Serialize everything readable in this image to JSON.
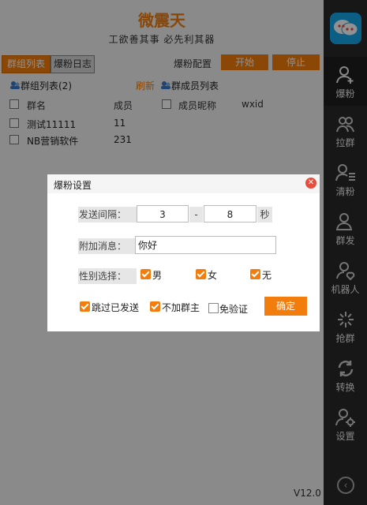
{
  "app": {
    "title": "微震天",
    "subtitle": "工欲善其事 必先利其器",
    "version": "V12.0",
    "accent_color": "#f27d0c",
    "sidebar_color": "#2a2a2a"
  },
  "tabs": {
    "group_list": "群组列表",
    "log": "爆粉日志"
  },
  "toolbar": {
    "config_label": "爆粉配置",
    "start": "开始",
    "stop": "停止"
  },
  "groups": {
    "header": "群组列表(2)",
    "refresh": "刷新",
    "col_name": "群名",
    "col_members": "成员",
    "rows": [
      {
        "name": "测试11111",
        "members": "11"
      },
      {
        "name": "NB营销软件",
        "members": "231"
      }
    ]
  },
  "members": {
    "header": "群成员列表",
    "col_nickname": "成员昵称",
    "col_wxid": "wxid"
  },
  "sidebar": {
    "items": [
      {
        "label": "爆粉",
        "icon": "person-add-icon"
      },
      {
        "label": "拉群",
        "icon": "group-icon"
      },
      {
        "label": "清粉",
        "icon": "person-list-icon"
      },
      {
        "label": "群发",
        "icon": "person-broadcast-icon"
      },
      {
        "label": "机器人",
        "icon": "robot-person-icon"
      },
      {
        "label": "抢群",
        "icon": "sparkle-icon"
      },
      {
        "label": "转换",
        "icon": "refresh-icon"
      },
      {
        "label": "设置",
        "icon": "person-gear-icon"
      }
    ]
  },
  "dialog": {
    "title": "爆粉设置",
    "interval_label": "发送间隔：",
    "interval_min": "3",
    "interval_sep": "-",
    "interval_max": "8",
    "interval_unit": "秒",
    "message_label": "附加消息：",
    "message_value": "你好",
    "gender_label": "性别选择：",
    "gender_male": "男",
    "gender_female": "女",
    "gender_none": "无",
    "skip_sent": "跳过已发送",
    "no_owner": "不加群主",
    "no_verify": "免验证",
    "ok": "确定"
  }
}
